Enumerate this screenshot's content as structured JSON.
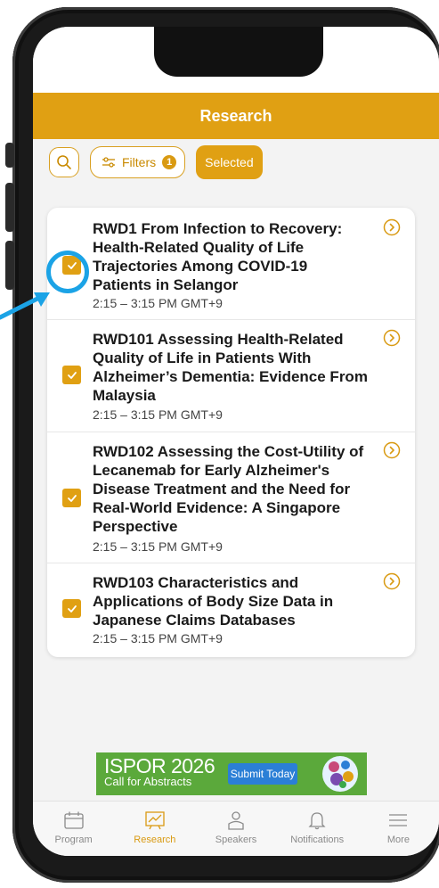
{
  "header": {
    "title": "Research"
  },
  "toolbar": {
    "search_icon": "search-icon",
    "filters_label": "Filters",
    "filters_count": "1",
    "selected_label": "Selected"
  },
  "sessions": [
    {
      "title": "RWD1 From Infection to Recovery: Health-Related Quality of Life Trajectories Among COVID-19 Patients in Selangor",
      "time": "2:15 – 3:15 PM GMT+9",
      "checked": true
    },
    {
      "title": "RWD101 Assessing Health-Related Quality of Life in Patients With Alzheimer’s Dementia: Evidence From Malaysia",
      "time": "2:15 – 3:15 PM GMT+9",
      "checked": true
    },
    {
      "title": "RWD102 Assessing the Cost-Utility of Lecanemab for Early Alzheimer's Disease Treatment and the Need for Real-World Evidence: A Singapore Perspective",
      "time": "2:15 – 3:15 PM GMT+9",
      "checked": true
    },
    {
      "title": "RWD103 Characteristics and Applications of Body Size Data in Japanese Claims Databases",
      "time": "2:15 – 3:15 PM GMT+9",
      "checked": true
    }
  ],
  "banner": {
    "title": "ISPOR 2026",
    "subtitle": "Call for Abstracts",
    "button": "Submit Today"
  },
  "tabs": [
    {
      "label": "Program",
      "icon": "calendar-icon",
      "active": false
    },
    {
      "label": "Research",
      "icon": "chart-icon",
      "active": true
    },
    {
      "label": "Speakers",
      "icon": "person-icon",
      "active": false
    },
    {
      "label": "Notifications",
      "icon": "bell-icon",
      "active": false
    },
    {
      "label": "More",
      "icon": "menu-icon",
      "active": false
    }
  ],
  "colors": {
    "accent": "#e0a013",
    "highlight": "#1ba3e6",
    "banner": "#5ba93b"
  }
}
